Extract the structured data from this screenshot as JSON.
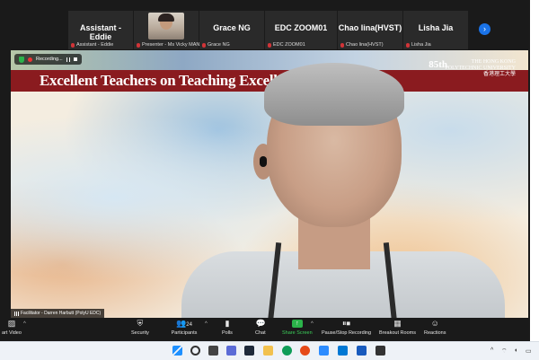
{
  "participants": [
    {
      "big_name": "Assistant - Eddie",
      "label": "Assistant - Eddie"
    },
    {
      "big_name": "",
      "label": "Presenter - Ms Vicky MAN"
    },
    {
      "big_name": "Grace NG",
      "label": "Grace NG"
    },
    {
      "big_name": "EDC ZOOM01",
      "label": "EDC ZOOM01"
    },
    {
      "big_name": "Chao lina(HVST)",
      "label": "Chao lina(HVST)"
    },
    {
      "big_name": "Lisha Jia",
      "label": "Lisha Jia"
    }
  ],
  "next_page_glyph": "›",
  "recording": {
    "label": "Recording..."
  },
  "banner": {
    "title": "Excellent Teachers on Teaching Excellen",
    "anniversary": "85th",
    "logo_line1": "THE HONG KONG",
    "logo_line2": "POLYTECHNIC UNIVERSITY",
    "logo_line3": "香港理工大學"
  },
  "speaker_label": "Facilitator - Darren Harbutt (PolyU EDC)",
  "toolbar": {
    "start_video": "art Video",
    "security": "Security",
    "participants": "Participants",
    "participants_count": "24",
    "polls": "Polls",
    "chat": "Chat",
    "share_screen": "Share Screen",
    "recording": "Pause/Stop Recording",
    "breakout": "Breakout Rooms",
    "reactions": "Reactions"
  },
  "icons": {
    "security": "shield-icon",
    "participants": "people-icon",
    "polls": "polls-icon",
    "chat": "chat-icon",
    "share": "share-screen-icon",
    "record": "pause-stop-icon",
    "breakout": "breakout-rooms-icon",
    "reactions": "emoji-icon"
  },
  "colors": {
    "zoom_bg": "#1a1a1a",
    "banner_red": "#8a1b1f",
    "share_green": "#2bb34a",
    "next_blue": "#1a73e8",
    "mic_off_red": "#d13438"
  }
}
